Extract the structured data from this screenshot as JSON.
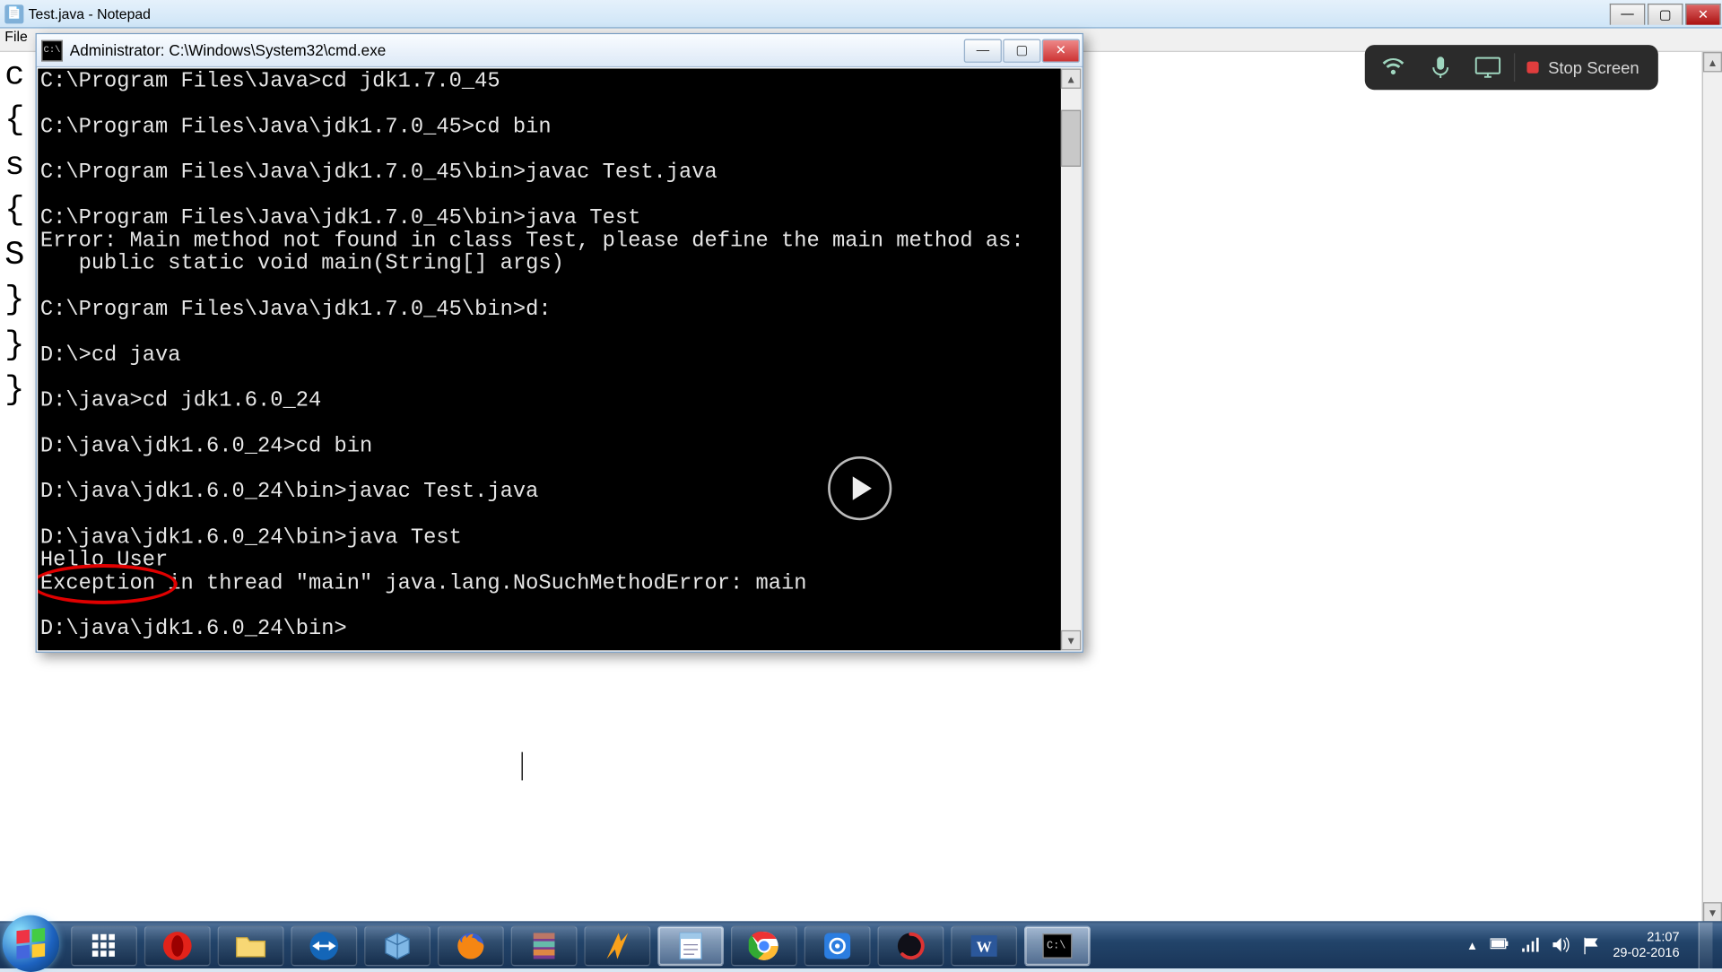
{
  "notepad": {
    "title": "Test.java - Notepad",
    "menu_file": "File",
    "content_lines": [
      "c",
      "{",
      "s",
      "{",
      "S",
      "}",
      "}",
      "}"
    ]
  },
  "cmd": {
    "title": "Administrator: C:\\Windows\\System32\\cmd.exe",
    "lines": [
      "C:\\Program Files\\Java>cd jdk1.7.0_45",
      "",
      "C:\\Program Files\\Java\\jdk1.7.0_45>cd bin",
      "",
      "C:\\Program Files\\Java\\jdk1.7.0_45\\bin>javac Test.java",
      "",
      "C:\\Program Files\\Java\\jdk1.7.0_45\\bin>java Test",
      "Error: Main method not found in class Test, please define the main method as:",
      "   public static void main(String[] args)",
      "",
      "C:\\Program Files\\Java\\jdk1.7.0_45\\bin>d:",
      "",
      "D:\\>cd java",
      "",
      "D:\\java>cd jdk1.6.0_24",
      "",
      "D:\\java\\jdk1.6.0_24>cd bin",
      "",
      "D:\\java\\jdk1.6.0_24\\bin>javac Test.java",
      "",
      "D:\\java\\jdk1.6.0_24\\bin>java Test",
      "Hello User",
      "Exception in thread \"main\" java.lang.NoSuchMethodError: main",
      "",
      "D:\\java\\jdk1.6.0_24\\bin>"
    ],
    "annot_line_index": 22
  },
  "screencast": {
    "stop_label": "Stop Screen"
  },
  "taskbar": {
    "clock_time": "21:07",
    "clock_date": "29-02-2016"
  }
}
